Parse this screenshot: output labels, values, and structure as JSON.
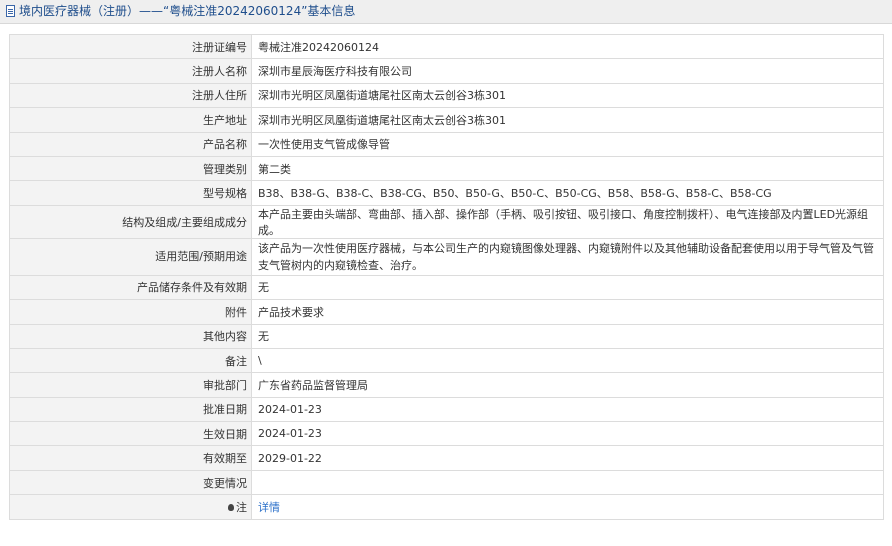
{
  "header": {
    "title": "境内医疗器械（注册）——“粤械注准20242060124”基本信息"
  },
  "rows": [
    {
      "label": "注册证编号",
      "value": "粤械注准20242060124"
    },
    {
      "label": "注册人名称",
      "value": "深圳市星辰海医疗科技有限公司"
    },
    {
      "label": "注册人住所",
      "value": "深圳市光明区凤凰街道塘尾社区南太云创谷3栋301"
    },
    {
      "label": "生产地址",
      "value": "深圳市光明区凤凰街道塘尾社区南太云创谷3栋301"
    },
    {
      "label": "产品名称",
      "value": "一次性使用支气管成像导管"
    },
    {
      "label": "管理类别",
      "value": "第二类"
    },
    {
      "label": "型号规格",
      "value": "B38、B38-G、B38-C、B38-CG、B50、B50-G、B50-C、B50-CG、B58、B58-G、B58-C、B58-CG"
    },
    {
      "label": "结构及组成/主要组成成分",
      "value": "本产品主要由头端部、弯曲部、插入部、操作部（手柄、吸引按钮、吸引接口、角度控制拨杆）、电气连接部及内置LED光源组成。"
    },
    {
      "label": "适用范围/预期用途",
      "value": "该产品为一次性使用医疗器械，与本公司生产的内窥镜图像处理器、内窥镜附件以及其他辅助设备配套使用以用于导气管及气管支气管树内的内窥镜检查、治疗。"
    },
    {
      "label": "产品储存条件及有效期",
      "value": "无"
    },
    {
      "label": "附件",
      "value": "产品技术要求"
    },
    {
      "label": "其他内容",
      "value": "无"
    },
    {
      "label": "备注",
      "value": "\\"
    },
    {
      "label": "审批部门",
      "value": "广东省药品监督管理局"
    },
    {
      "label": "批准日期",
      "value": "2024-01-23"
    },
    {
      "label": "生效日期",
      "value": "2024-01-23"
    },
    {
      "label": "有效期至",
      "value": "2029-01-22"
    },
    {
      "label": "变更情况",
      "value": ""
    }
  ],
  "note": {
    "label": "注",
    "link": "详情",
    "icon": "lightbulb-icon"
  }
}
